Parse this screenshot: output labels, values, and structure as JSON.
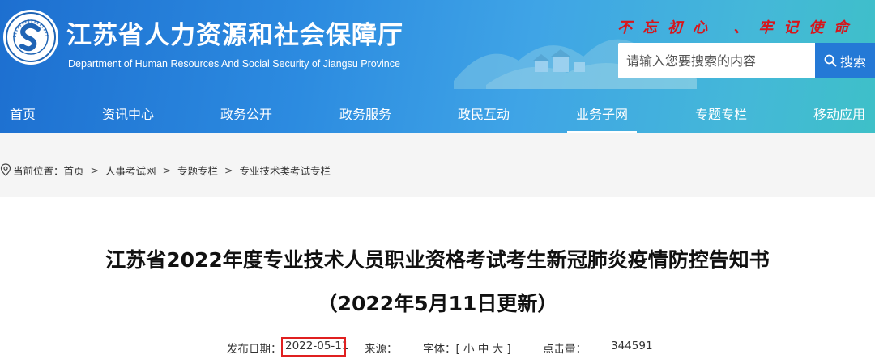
{
  "header": {
    "title_cn": "江苏省人力资源和社会保障厅",
    "title_en": "Department of Human Resources And Social Security of Jiangsu Province",
    "slogan": "不忘初心 、牢记使命",
    "search": {
      "placeholder": "请输入您要搜索的内容",
      "button_label": "搜索"
    },
    "colors": {
      "banner_start": "#1d6fd0",
      "banner_end": "#3ec0c8",
      "slogan": "#d8141a"
    }
  },
  "nav": {
    "items": [
      {
        "label": "首页"
      },
      {
        "label": "资讯中心"
      },
      {
        "label": "政务公开"
      },
      {
        "label": "政务服务"
      },
      {
        "label": "政民互动"
      },
      {
        "label": "业务子网"
      },
      {
        "label": "专题专栏"
      },
      {
        "label": "移动应用"
      }
    ],
    "active": "业务子网"
  },
  "breadcrumb": {
    "prefix": "当前位置：",
    "items": [
      "首页",
      "人事考试网",
      "专题专栏",
      "专业技术类考试专栏"
    ],
    "separator": ">"
  },
  "article": {
    "title_line1": "江苏省2022年度专业技术人员职业资格考试考生新冠肺炎疫情防控告知书",
    "title_line2": "（2022年5月11日更新）",
    "meta": {
      "date_label": "发布日期：",
      "date": "2022-05-11",
      "source_label": "来源：",
      "source": "",
      "font_label": "字体：[ 小 中 大 ]",
      "hits_label": "点击量：",
      "hits": "344591"
    },
    "highlight_color": "#e02020"
  }
}
